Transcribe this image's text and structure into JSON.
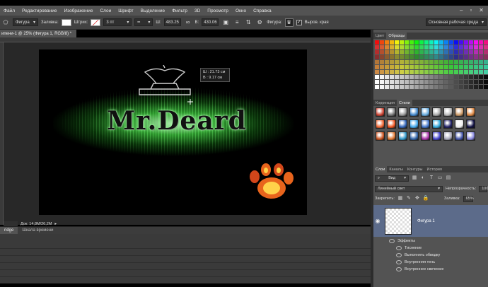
{
  "menu": [
    "Файл",
    "Редактирование",
    "Изображение",
    "Слои",
    "Шрифт",
    "Выделение",
    "Фильтр",
    "3D",
    "Просмотр",
    "Окно",
    "Справка"
  ],
  "options": {
    "shape_mode": "Фигура",
    "fill_label": "Заливка:",
    "stroke_label": "Штрих:",
    "stroke_width": "3 пт",
    "w_label": "Ш:",
    "w_value": "483.25",
    "h_label": "В:",
    "h_value": "430.06",
    "figure_label": "Фигура:",
    "align_edges": "Выров. края",
    "workspace": "Основная рабочая среда"
  },
  "doc_tab": "ипени-1 @ 25% (Фигура 1, RGB/8) *",
  "canvas": {
    "logo_text": "Mr.Deard",
    "tooltip_w": "Ш :   21.73 см",
    "tooltip_h": "В :    9.17 см"
  },
  "status": {
    "doc_info": "Док: 14,8M/26,2M"
  },
  "timeline_tabs": [
    "ridge",
    "Шкала времени"
  ],
  "panels": {
    "color_tabs": [
      "Цвет",
      "Образцы"
    ],
    "style_tabs": [
      "Коррекция",
      "Стили"
    ],
    "layer_tabs": [
      "Слои",
      "Каналы",
      "Контуры",
      "История"
    ]
  },
  "layers": {
    "filter_kind": "Вид",
    "blend_mode": "Линейный свет",
    "opacity_label": "Непрозрачность:",
    "opacity_value": "100",
    "lock_label": "Закрепить:",
    "fill_label": "Заливка:",
    "fill_value": "65%",
    "layer_name": "Фигура 1",
    "effects_header": "Эффекты",
    "effects": [
      "Тиснение",
      "Выполнить обводку",
      "Внутренняя тень",
      "Внутреннее свечение"
    ]
  },
  "colors": {
    "ui_bg": "#535353",
    "selected_layer": "#5c6b8a",
    "glow": "#3cc83c"
  }
}
